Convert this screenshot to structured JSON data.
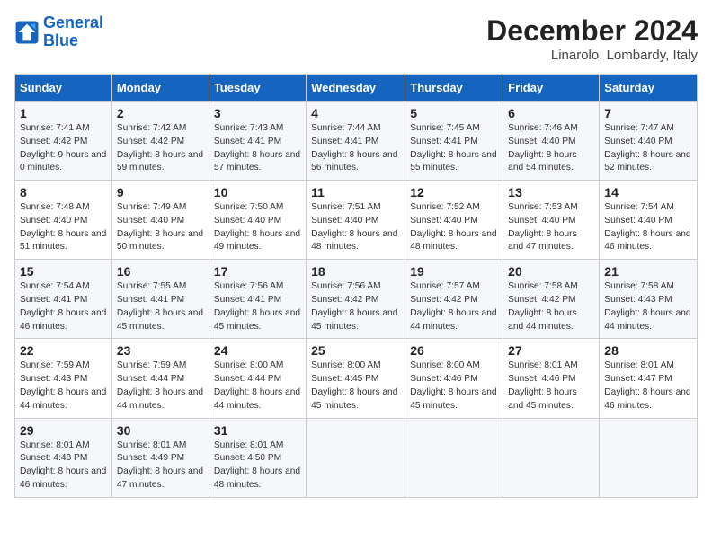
{
  "logo": {
    "line1": "General",
    "line2": "Blue"
  },
  "title": "December 2024",
  "location": "Linarolo, Lombardy, Italy",
  "days_of_week": [
    "Sunday",
    "Monday",
    "Tuesday",
    "Wednesday",
    "Thursday",
    "Friday",
    "Saturday"
  ],
  "weeks": [
    [
      {
        "day": "1",
        "sunrise": "Sunrise: 7:41 AM",
        "sunset": "Sunset: 4:42 PM",
        "daylight": "Daylight: 9 hours and 0 minutes."
      },
      {
        "day": "2",
        "sunrise": "Sunrise: 7:42 AM",
        "sunset": "Sunset: 4:42 PM",
        "daylight": "Daylight: 8 hours and 59 minutes."
      },
      {
        "day": "3",
        "sunrise": "Sunrise: 7:43 AM",
        "sunset": "Sunset: 4:41 PM",
        "daylight": "Daylight: 8 hours and 57 minutes."
      },
      {
        "day": "4",
        "sunrise": "Sunrise: 7:44 AM",
        "sunset": "Sunset: 4:41 PM",
        "daylight": "Daylight: 8 hours and 56 minutes."
      },
      {
        "day": "5",
        "sunrise": "Sunrise: 7:45 AM",
        "sunset": "Sunset: 4:41 PM",
        "daylight": "Daylight: 8 hours and 55 minutes."
      },
      {
        "day": "6",
        "sunrise": "Sunrise: 7:46 AM",
        "sunset": "Sunset: 4:40 PM",
        "daylight": "Daylight: 8 hours and 54 minutes."
      },
      {
        "day": "7",
        "sunrise": "Sunrise: 7:47 AM",
        "sunset": "Sunset: 4:40 PM",
        "daylight": "Daylight: 8 hours and 52 minutes."
      }
    ],
    [
      {
        "day": "8",
        "sunrise": "Sunrise: 7:48 AM",
        "sunset": "Sunset: 4:40 PM",
        "daylight": "Daylight: 8 hours and 51 minutes."
      },
      {
        "day": "9",
        "sunrise": "Sunrise: 7:49 AM",
        "sunset": "Sunset: 4:40 PM",
        "daylight": "Daylight: 8 hours and 50 minutes."
      },
      {
        "day": "10",
        "sunrise": "Sunrise: 7:50 AM",
        "sunset": "Sunset: 4:40 PM",
        "daylight": "Daylight: 8 hours and 49 minutes."
      },
      {
        "day": "11",
        "sunrise": "Sunrise: 7:51 AM",
        "sunset": "Sunset: 4:40 PM",
        "daylight": "Daylight: 8 hours and 48 minutes."
      },
      {
        "day": "12",
        "sunrise": "Sunrise: 7:52 AM",
        "sunset": "Sunset: 4:40 PM",
        "daylight": "Daylight: 8 hours and 48 minutes."
      },
      {
        "day": "13",
        "sunrise": "Sunrise: 7:53 AM",
        "sunset": "Sunset: 4:40 PM",
        "daylight": "Daylight: 8 hours and 47 minutes."
      },
      {
        "day": "14",
        "sunrise": "Sunrise: 7:54 AM",
        "sunset": "Sunset: 4:40 PM",
        "daylight": "Daylight: 8 hours and 46 minutes."
      }
    ],
    [
      {
        "day": "15",
        "sunrise": "Sunrise: 7:54 AM",
        "sunset": "Sunset: 4:41 PM",
        "daylight": "Daylight: 8 hours and 46 minutes."
      },
      {
        "day": "16",
        "sunrise": "Sunrise: 7:55 AM",
        "sunset": "Sunset: 4:41 PM",
        "daylight": "Daylight: 8 hours and 45 minutes."
      },
      {
        "day": "17",
        "sunrise": "Sunrise: 7:56 AM",
        "sunset": "Sunset: 4:41 PM",
        "daylight": "Daylight: 8 hours and 45 minutes."
      },
      {
        "day": "18",
        "sunrise": "Sunrise: 7:56 AM",
        "sunset": "Sunset: 4:42 PM",
        "daylight": "Daylight: 8 hours and 45 minutes."
      },
      {
        "day": "19",
        "sunrise": "Sunrise: 7:57 AM",
        "sunset": "Sunset: 4:42 PM",
        "daylight": "Daylight: 8 hours and 44 minutes."
      },
      {
        "day": "20",
        "sunrise": "Sunrise: 7:58 AM",
        "sunset": "Sunset: 4:42 PM",
        "daylight": "Daylight: 8 hours and 44 minutes."
      },
      {
        "day": "21",
        "sunrise": "Sunrise: 7:58 AM",
        "sunset": "Sunset: 4:43 PM",
        "daylight": "Daylight: 8 hours and 44 minutes."
      }
    ],
    [
      {
        "day": "22",
        "sunrise": "Sunrise: 7:59 AM",
        "sunset": "Sunset: 4:43 PM",
        "daylight": "Daylight: 8 hours and 44 minutes."
      },
      {
        "day": "23",
        "sunrise": "Sunrise: 7:59 AM",
        "sunset": "Sunset: 4:44 PM",
        "daylight": "Daylight: 8 hours and 44 minutes."
      },
      {
        "day": "24",
        "sunrise": "Sunrise: 8:00 AM",
        "sunset": "Sunset: 4:44 PM",
        "daylight": "Daylight: 8 hours and 44 minutes."
      },
      {
        "day": "25",
        "sunrise": "Sunrise: 8:00 AM",
        "sunset": "Sunset: 4:45 PM",
        "daylight": "Daylight: 8 hours and 45 minutes."
      },
      {
        "day": "26",
        "sunrise": "Sunrise: 8:00 AM",
        "sunset": "Sunset: 4:46 PM",
        "daylight": "Daylight: 8 hours and 45 minutes."
      },
      {
        "day": "27",
        "sunrise": "Sunrise: 8:01 AM",
        "sunset": "Sunset: 4:46 PM",
        "daylight": "Daylight: 8 hours and 45 minutes."
      },
      {
        "day": "28",
        "sunrise": "Sunrise: 8:01 AM",
        "sunset": "Sunset: 4:47 PM",
        "daylight": "Daylight: 8 hours and 46 minutes."
      }
    ],
    [
      {
        "day": "29",
        "sunrise": "Sunrise: 8:01 AM",
        "sunset": "Sunset: 4:48 PM",
        "daylight": "Daylight: 8 hours and 46 minutes."
      },
      {
        "day": "30",
        "sunrise": "Sunrise: 8:01 AM",
        "sunset": "Sunset: 4:49 PM",
        "daylight": "Daylight: 8 hours and 47 minutes."
      },
      {
        "day": "31",
        "sunrise": "Sunrise: 8:01 AM",
        "sunset": "Sunset: 4:50 PM",
        "daylight": "Daylight: 8 hours and 48 minutes."
      },
      null,
      null,
      null,
      null
    ]
  ]
}
